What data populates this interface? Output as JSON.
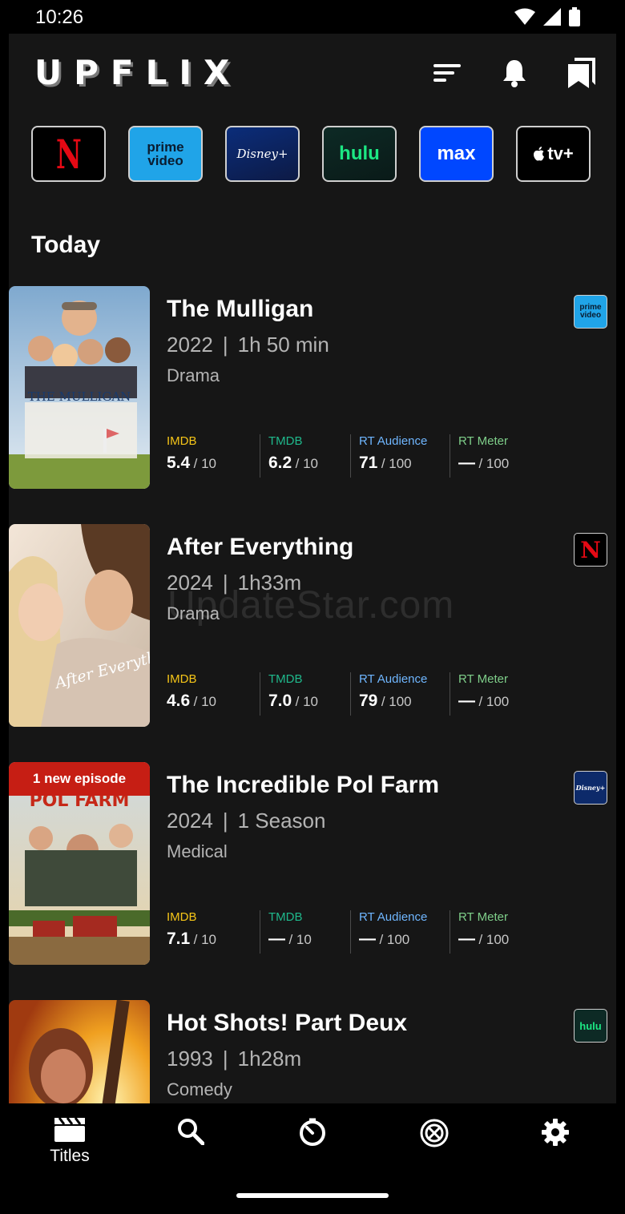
{
  "status_bar": {
    "time": "10:26",
    "icons": [
      "wifi-icon",
      "signal-icon",
      "battery-icon"
    ]
  },
  "header": {
    "logo": "UPFLIX",
    "actions": [
      "sort-icon",
      "bell-icon",
      "bookmarks-icon"
    ]
  },
  "services": [
    {
      "name": "Netflix",
      "label": "N"
    },
    {
      "name": "Prime Video",
      "label": "prime video"
    },
    {
      "name": "Disney+",
      "label": "Disney+"
    },
    {
      "name": "Hulu",
      "label": "hulu"
    },
    {
      "name": "Max",
      "label": "max"
    },
    {
      "name": "Apple TV+",
      "label": "tv+"
    }
  ],
  "section": {
    "title": "Today"
  },
  "titles": [
    {
      "title": "The Mulligan",
      "year": "2022",
      "duration": "1h 50 min",
      "genre": "Drama",
      "service_label": "prime video",
      "poster_text": "THE MULLIGAN",
      "badge": "",
      "ratings": {
        "imdb": {
          "label": "IMDB",
          "value": "5.4",
          "scale": "/ 10"
        },
        "tmdb": {
          "label": "TMDB",
          "value": "6.2",
          "scale": "/ 10"
        },
        "rt_audience": {
          "label": "RT Audience",
          "value": "71",
          "scale": "/ 100"
        },
        "rt_meter": {
          "label": "RT Meter",
          "value": "—",
          "scale": "/ 100"
        }
      }
    },
    {
      "title": "After Everything",
      "year": "2024",
      "duration": "1h33m",
      "genre": "Drama",
      "service_label": "N",
      "poster_text": "After Everything",
      "badge": "",
      "ratings": {
        "imdb": {
          "label": "IMDB",
          "value": "4.6",
          "scale": "/ 10"
        },
        "tmdb": {
          "label": "TMDB",
          "value": "7.0",
          "scale": "/ 10"
        },
        "rt_audience": {
          "label": "RT Audience",
          "value": "79",
          "scale": "/ 100"
        },
        "rt_meter": {
          "label": "RT Meter",
          "value": "—",
          "scale": "/ 100"
        }
      }
    },
    {
      "title": "The Incredible Pol Farm",
      "year": "2024",
      "duration": "1 Season",
      "genre": "Medical",
      "service_label": "Disney+",
      "poster_text": "POL FARM",
      "badge": "1 new episode",
      "ratings": {
        "imdb": {
          "label": "IMDB",
          "value": "7.1",
          "scale": "/ 10"
        },
        "tmdb": {
          "label": "TMDB",
          "value": "—",
          "scale": "/ 10"
        },
        "rt_audience": {
          "label": "RT Audience",
          "value": "—",
          "scale": "/ 100"
        },
        "rt_meter": {
          "label": "RT Meter",
          "value": "—",
          "scale": "/ 100"
        }
      }
    },
    {
      "title": "Hot Shots! Part Deux",
      "year": "1993",
      "duration": "1h28m",
      "genre": "Comedy",
      "service_label": "hulu",
      "poster_text": "",
      "badge": ""
    }
  ],
  "watermark": "UpdateStar.com",
  "bottom_nav": {
    "items": [
      {
        "icon": "clapperboard-icon",
        "label": "Titles",
        "active": true
      },
      {
        "icon": "search-icon",
        "label": ""
      },
      {
        "icon": "timer-icon",
        "label": ""
      },
      {
        "icon": "reel-icon",
        "label": ""
      },
      {
        "icon": "gear-icon",
        "label": ""
      }
    ]
  },
  "colors": {
    "background": "#161616",
    "imdb": "#f5c518",
    "tmdb": "#1fb98c",
    "rt_audience": "#6fb6ff",
    "rt_meter": "#7fcf8a",
    "badge": "#c61e14"
  }
}
